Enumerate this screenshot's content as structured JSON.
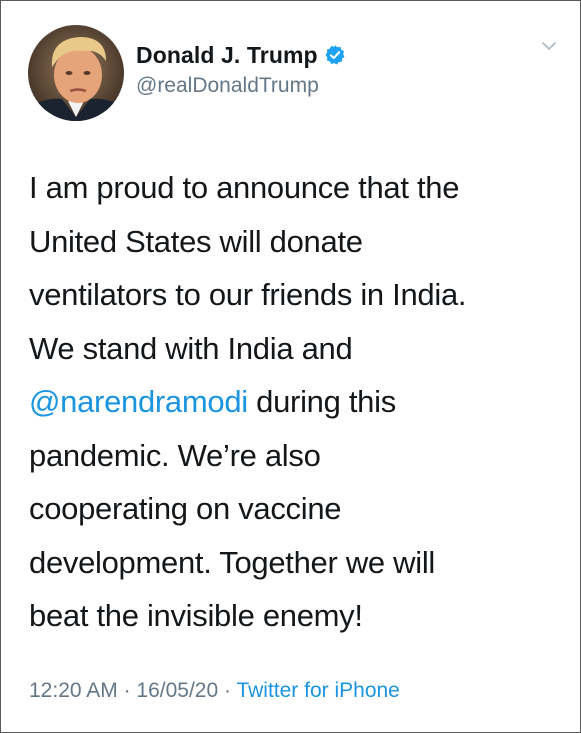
{
  "tweet": {
    "author": {
      "display_name": "Donald J. Trump",
      "handle": "@realDonaldTrump",
      "verified": true
    },
    "text_lines": [
      "I am proud to announce that the",
      "United States will donate",
      "ventilators to our friends in India.",
      "We stand with India and",
      {
        "mention": "@narendramodi",
        "rest": " during this"
      },
      "pandemic. We’re also",
      "cooperating on vaccine",
      "development. Together we will",
      "beat the invisible enemy!"
    ],
    "time": "12:20 AM",
    "date": "16/05/20",
    "separator": " · ",
    "source": "Twitter for iPhone"
  },
  "icons": {
    "verified": "verified-badge-icon",
    "menu": "chevron-down-icon"
  },
  "colors": {
    "text": "#14171a",
    "secondary": "#657786",
    "link": "#1b95e0",
    "verified": "#1da1f2"
  }
}
